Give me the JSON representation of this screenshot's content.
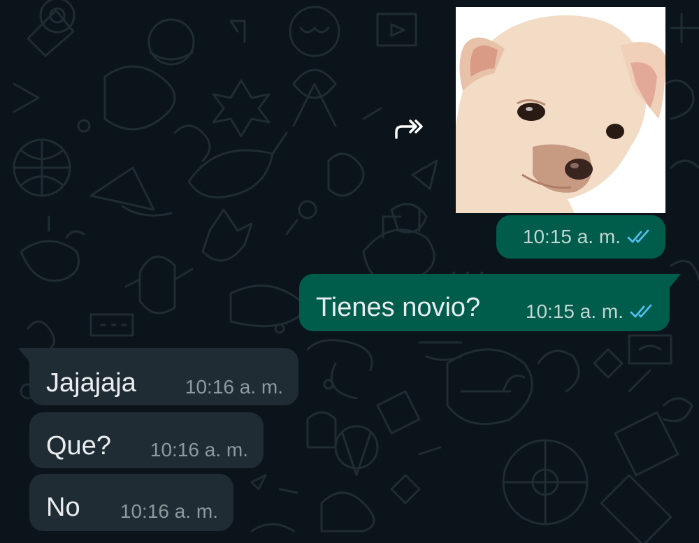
{
  "conversation": {
    "forward_icon": "forward-icon",
    "read_icon": "double-check-icon",
    "colors": {
      "background": "#0b141a",
      "outgoing": "#005c4b",
      "incoming": "#202c33",
      "read_ticks": "#53bdeb"
    },
    "sticker_message": {
      "sticker": "sad-puppy-sticker",
      "time": "10:15 a. m."
    },
    "messages": [
      {
        "direction": "outgoing",
        "text": "Tienes novio?",
        "time": "10:15 a. m."
      },
      {
        "direction": "incoming",
        "text": "Jajajaja",
        "time": "10:16 a. m."
      },
      {
        "direction": "incoming",
        "text": "Que?",
        "time": "10:16 a. m."
      },
      {
        "direction": "incoming",
        "text": "No",
        "time": "10:16 a. m."
      }
    ]
  }
}
